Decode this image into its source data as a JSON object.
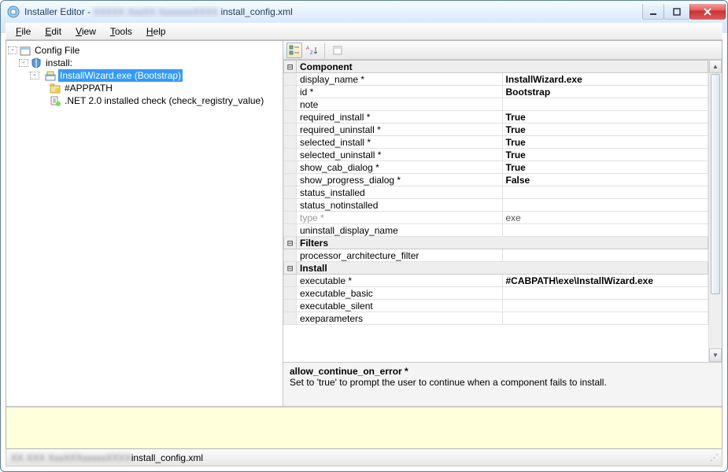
{
  "window": {
    "title_prefix": "Installer Editor - ",
    "title_file": " install_config.xml"
  },
  "menu": [
    "File",
    "Edit",
    "View",
    "Tools",
    "Help"
  ],
  "tree": {
    "root": "Config File",
    "install": "install:",
    "selected": "InstallWizard.exe (Bootstrap)",
    "child1": "#APPPATH",
    "child2": ".NET 2.0 installed check (check_registry_value)"
  },
  "groups": [
    {
      "name": "Component",
      "rows": [
        {
          "k": "display_name *",
          "v": "InstallWizard.exe"
        },
        {
          "k": "id *",
          "v": "Bootstrap"
        },
        {
          "k": "note",
          "v": ""
        },
        {
          "k": "required_install *",
          "v": "True"
        },
        {
          "k": "required_uninstall *",
          "v": "True"
        },
        {
          "k": "selected_install *",
          "v": "True"
        },
        {
          "k": "selected_uninstall *",
          "v": "True"
        },
        {
          "k": "show_cab_dialog *",
          "v": "True"
        },
        {
          "k": "show_progress_dialog *",
          "v": "False"
        },
        {
          "k": "status_installed",
          "v": ""
        },
        {
          "k": "status_notinstalled",
          "v": ""
        },
        {
          "k": "type *",
          "v": "exe",
          "ro": true
        },
        {
          "k": "uninstall_display_name",
          "v": ""
        }
      ]
    },
    {
      "name": "Filters",
      "rows": [
        {
          "k": "processor_architecture_filter",
          "v": ""
        }
      ]
    },
    {
      "name": "Install",
      "rows": [
        {
          "k": "executable *",
          "v": "#CABPATH\\exe\\InstallWizard.exe"
        },
        {
          "k": "executable_basic",
          "v": ""
        },
        {
          "k": "executable_silent",
          "v": ""
        },
        {
          "k": "exeparameters",
          "v": ""
        }
      ]
    }
  ],
  "help": {
    "title": "allow_continue_on_error *",
    "desc": "Set to 'true' to prompt the user to continue when a component fails to install."
  },
  "status": {
    "file": "install_config.xml"
  }
}
